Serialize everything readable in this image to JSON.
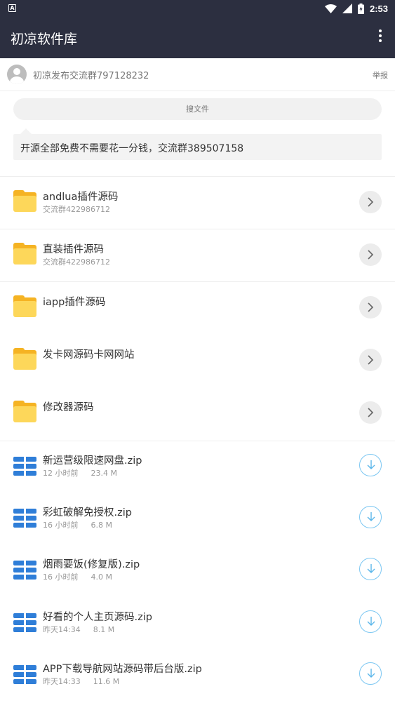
{
  "status_bar": {
    "notification_icon": "A",
    "time": "2:53",
    "icons": [
      "wifi-icon",
      "signal-icon",
      "battery-icon"
    ]
  },
  "app_bar": {
    "title": "初凉软件库",
    "menu_icon": "more-vert-icon"
  },
  "owner": {
    "name": "初凉发布交流群797128232",
    "report_label": "举报"
  },
  "search": {
    "placeholder": "搜文件"
  },
  "notice": {
    "text": "开源全部免费不需要花一分钱，交流群389507158"
  },
  "folders": [
    {
      "name": "andlua插件源码",
      "subtitle": "交流群422986712"
    },
    {
      "name": "直装插件源码",
      "subtitle": "交流群422986712"
    },
    {
      "name": "iapp插件源码",
      "subtitle": ""
    },
    {
      "name": "发卡网源码卡网网站",
      "subtitle": ""
    },
    {
      "name": "修改器源码",
      "subtitle": ""
    }
  ],
  "files": [
    {
      "name": "新运营级限速网盘.zip",
      "time": "12 小时前",
      "size": "23.4 M"
    },
    {
      "name": "彩虹破解免授权.zip",
      "time": "16 小时前",
      "size": "6.8 M"
    },
    {
      "name": "烟雨要饭(修复版).zip",
      "time": "16 小时前",
      "size": "4.0 M"
    },
    {
      "name": "好看的个人主页源码.zip",
      "time": "昨天14:34",
      "size": "8.1 M"
    },
    {
      "name": "APP下载导航网站源码带后台版.zip",
      "time": "昨天14:33",
      "size": "11.6 M"
    }
  ],
  "colors": {
    "app_bar": "#2c2f40",
    "folder": "#fdd75a",
    "zip": "#2f7ed8",
    "download_ring": "#7cc7f2"
  }
}
